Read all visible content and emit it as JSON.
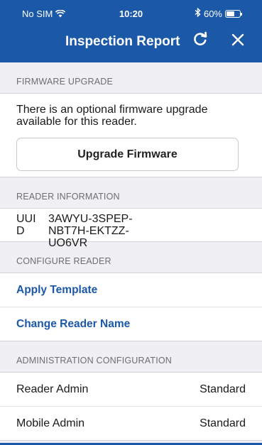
{
  "status_bar": {
    "carrier": "No SIM",
    "wifi_icon": "wifi-icon",
    "time": "10:20",
    "bluetooth_icon": "bluetooth-icon",
    "battery_percent": "60%",
    "battery_level": 0.6
  },
  "nav": {
    "title": "Inspection Report",
    "refresh_icon": "refresh-icon",
    "close_icon": "close-icon"
  },
  "firmware": {
    "header": "FIRMWARE UPGRADE",
    "message": "There is an optional firmware upgrade available for this reader.",
    "button_label": "Upgrade Firmware"
  },
  "reader_info": {
    "header": "READER INFORMATION",
    "uuid_label": "UUID",
    "uuid_value": "3AWYU-3SPEP-NBT7H-EKTZZ-UO6VR"
  },
  "configure": {
    "header": "CONFIGURE READER",
    "items": [
      {
        "label": "Apply Template"
      },
      {
        "label": "Change Reader Name"
      }
    ]
  },
  "admin": {
    "header": "ADMINISTRATION CONFIGURATION",
    "rows": [
      {
        "label": "Reader Admin",
        "value": "Standard"
      },
      {
        "label": "Mobile Admin",
        "value": "Standard"
      }
    ]
  },
  "colors": {
    "brand": "#1b58a7",
    "background": "#efeff4"
  }
}
